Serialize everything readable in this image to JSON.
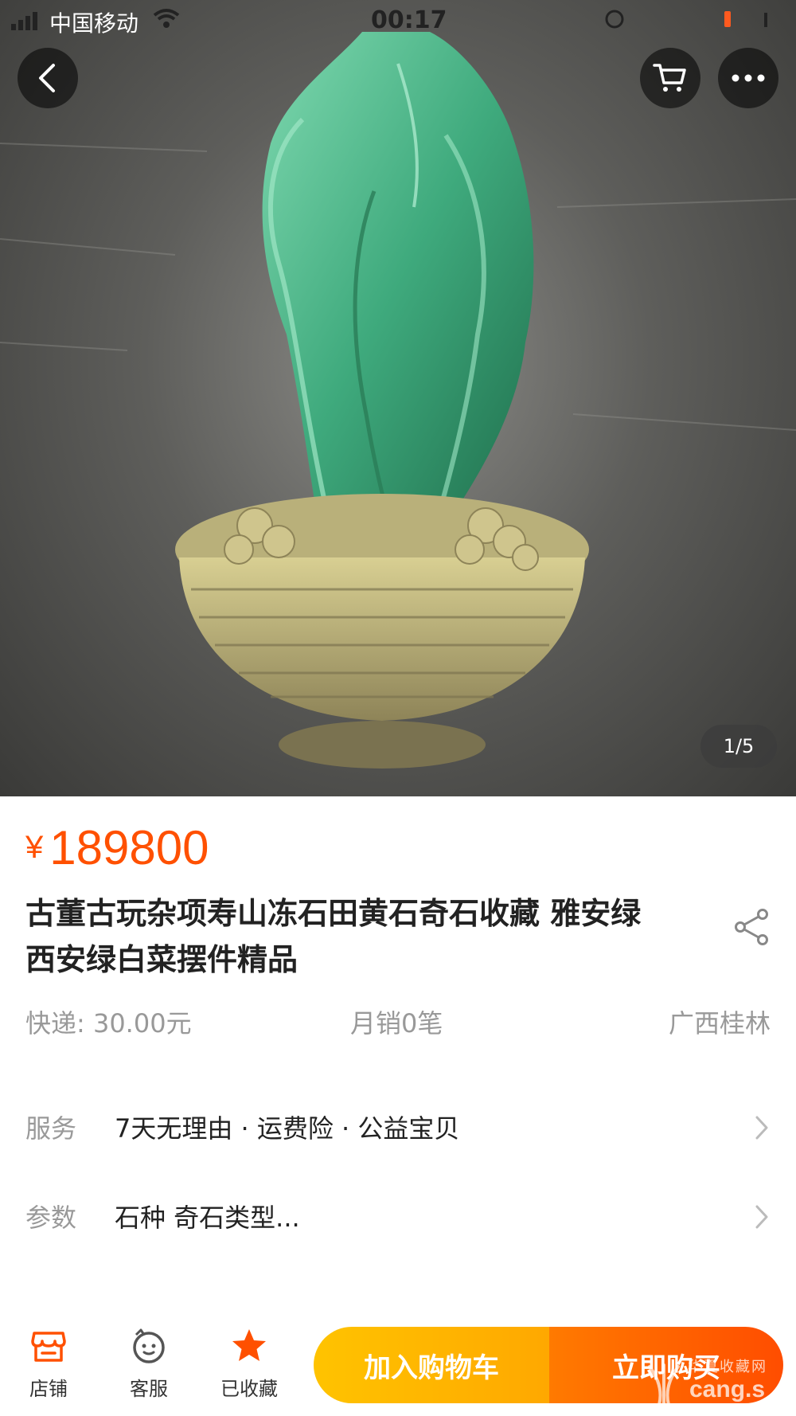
{
  "status_bar": {
    "carrier": "中国移动",
    "time": "00:17"
  },
  "header": {
    "back_icon": "chevron-left-icon",
    "cart_icon": "cart-icon",
    "more_icon": "more-dots-icon"
  },
  "gallery": {
    "page_indicator": "1/5",
    "current_index": 1,
    "total": 5
  },
  "product": {
    "currency_symbol": "¥",
    "price": "189800",
    "title": "古董古玩杂项寿山冻石田黄石奇石收藏 雅安绿 西安绿白菜摆件精品",
    "shipping": "快递: 30.00元",
    "monthly_sales": "月销0笔",
    "location": "广西桂林"
  },
  "rows": {
    "service_label": "服务",
    "service_value": "7天无理由 · 运费险 · 公益宝贝",
    "params_label": "参数",
    "params_value": "石种 奇石类型..."
  },
  "bottom_bar": {
    "store_label": "店铺",
    "service_label": "客服",
    "favorite_label": "已收藏",
    "add_to_cart": "加入购物车",
    "buy_now": "立即购买"
  },
  "watermark": {
    "cn": "华夏收藏网",
    "en": "cang.s"
  },
  "colors": {
    "accent": "#ff5000",
    "cart_button": "#ffb400",
    "buy_button": "#ff6000",
    "favorite_star": "#ff5000"
  }
}
